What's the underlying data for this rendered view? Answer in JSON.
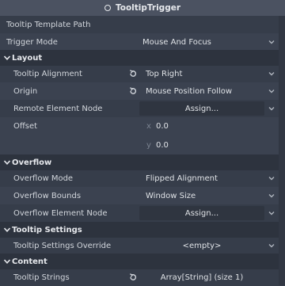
{
  "header": {
    "title": "TooltipTrigger"
  },
  "top_rows": [
    {
      "label": "Tooltip Template Path"
    },
    {
      "label": "Trigger Mode",
      "value": "Mouse And Focus"
    }
  ],
  "sections": {
    "layout": "Layout",
    "overflow": "Overflow",
    "tooltip_settings": "Tooltip Settings",
    "content": "Content"
  },
  "layout": {
    "tooltip_alignment": {
      "label": "Tooltip Alignment",
      "value": "Top Right"
    },
    "origin": {
      "label": "Origin",
      "value": "Mouse Position Follow"
    },
    "remote_element_node": {
      "label": "Remote Element Node",
      "value": "Assign..."
    },
    "offset": {
      "label": "Offset",
      "x_axis": "x",
      "x_value": "0.0",
      "y_axis": "y",
      "y_value": "0.0"
    }
  },
  "overflow": {
    "mode": {
      "label": "Overflow Mode",
      "value": "Flipped Alignment"
    },
    "bounds": {
      "label": "Overflow Bounds",
      "value": "Window Size"
    },
    "element_node": {
      "label": "Overflow Element Node",
      "value": "Assign..."
    }
  },
  "tooltip_settings": {
    "override": {
      "label": "Tooltip Settings Override",
      "value": "<empty>"
    }
  },
  "content": {
    "strings": {
      "label": "Tooltip Strings",
      "value": "Array[String] (size 1)"
    }
  },
  "icons": {
    "title": "node-icon",
    "section_chevron": "chevron-down-icon",
    "dropdown": "chevron-down-icon",
    "revert": "revert-icon"
  },
  "colors": {
    "background": "#363d4a",
    "section": "#2d333e",
    "header": "#4b5261",
    "field": "#2f3540"
  }
}
